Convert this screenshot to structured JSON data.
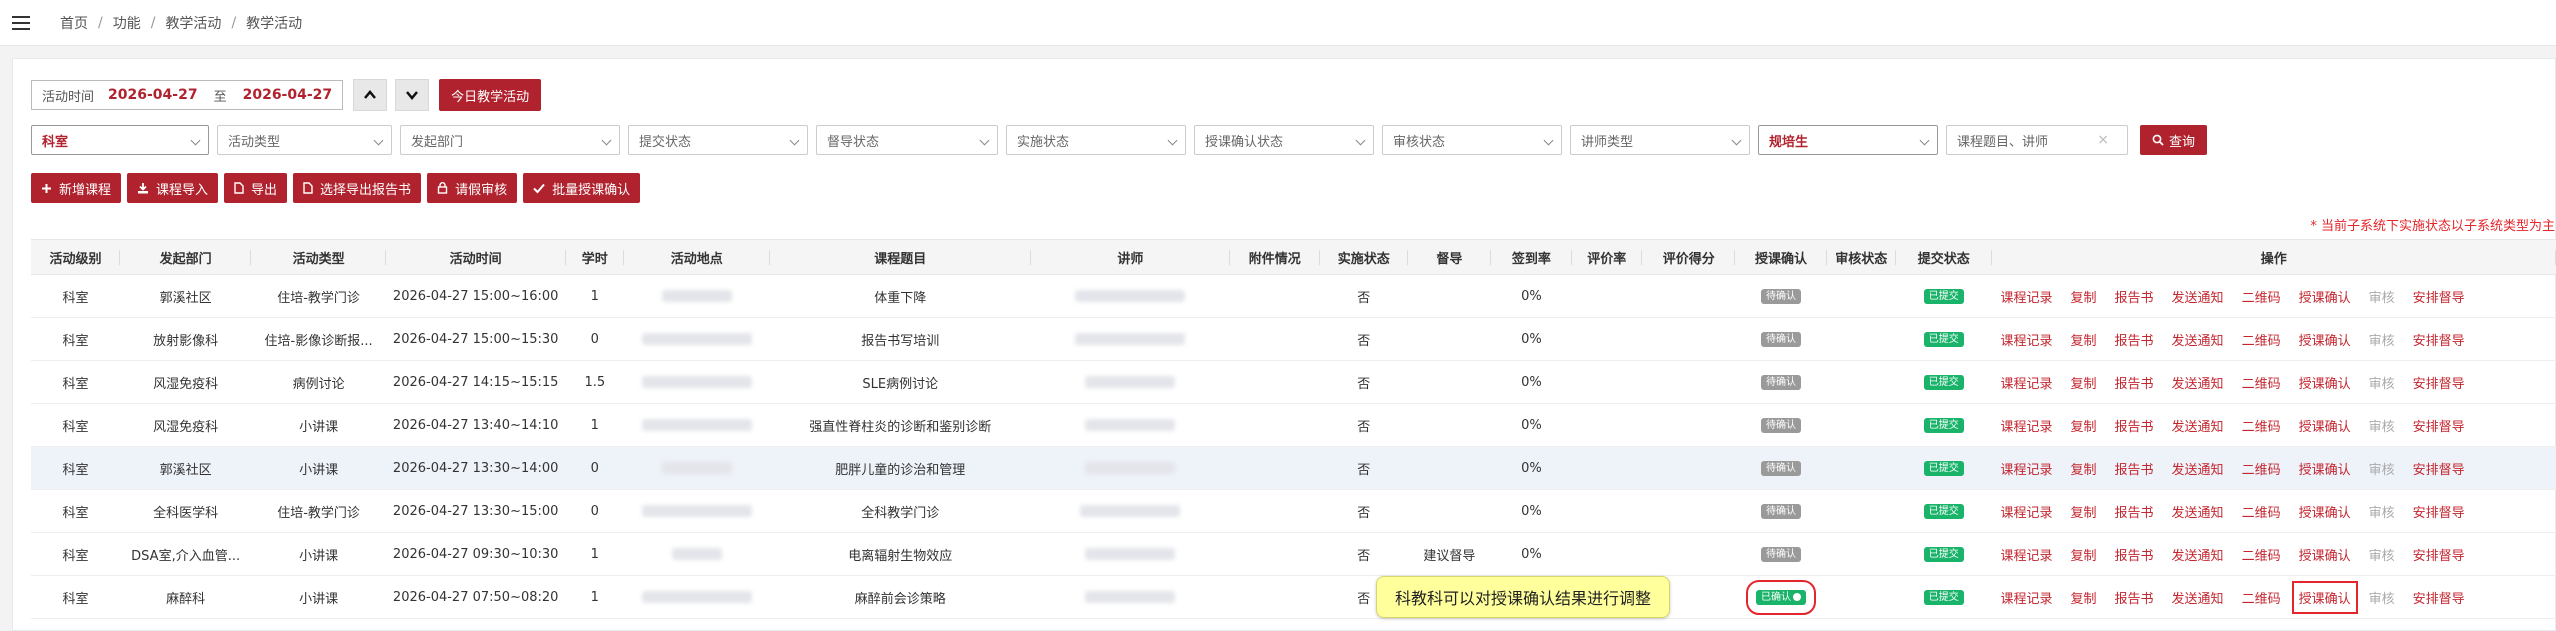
{
  "breadcrumb": [
    "首页",
    "功能",
    "教学活动",
    "教学活动"
  ],
  "datebar": {
    "label": "活动时间",
    "start": "2026-04-27",
    "to": "至",
    "end": "2026-04-27",
    "today_btn": "今日教学活动"
  },
  "filters": [
    {
      "name": "dept-level-select",
      "text": "科室",
      "width": 178,
      "highlight": true
    },
    {
      "name": "activity-type-select",
      "text": "活动类型",
      "width": 175
    },
    {
      "name": "org-dept-select",
      "text": "发起部门",
      "width": 220
    },
    {
      "name": "submit-status-select",
      "text": "提交状态",
      "width": 180
    },
    {
      "name": "supervise-status-select",
      "text": "督导状态",
      "width": 182
    },
    {
      "name": "impl-status-select",
      "text": "实施状态",
      "width": 180
    },
    {
      "name": "lecture-confirm-select",
      "text": "授课确认状态",
      "width": 180
    },
    {
      "name": "audit-status-select",
      "text": "审核状态",
      "width": 180
    },
    {
      "name": "lecturer-type-select",
      "text": "讲师类型",
      "width": 180
    },
    {
      "name": "trainee-select",
      "text": "规培生",
      "width": 180,
      "highlight": true
    },
    {
      "name": "keyword-input",
      "text": "课程题目、讲师",
      "width": 182,
      "clear": true
    }
  ],
  "query_btn": "查询",
  "actions": [
    {
      "name": "add-course-button",
      "icon": "plus",
      "label": "新增课程"
    },
    {
      "name": "import-course-button",
      "icon": "download",
      "label": "课程导入"
    },
    {
      "name": "export-button",
      "icon": "file",
      "label": "导出"
    },
    {
      "name": "export-report-button",
      "icon": "file",
      "label": "选择导出报告书"
    },
    {
      "name": "request-audit-button",
      "icon": "lock",
      "label": "请假审核"
    },
    {
      "name": "batch-confirm-button",
      "icon": "check",
      "label": "批量授课确认"
    }
  ],
  "note": "* 当前子系统下实施状态以子系统类型为主",
  "columns": [
    "活动级别",
    "发起部门",
    "活动类型",
    "活动时间",
    "学时",
    "活动地点",
    "课程题目",
    "讲师",
    "附件情况",
    "实施状态",
    "督导",
    "签到率",
    "评价率",
    "评价得分",
    "授课确认",
    "审核状态",
    "提交状态",
    "操作"
  ],
  "operations": [
    "课程记录",
    "复制",
    "报告书",
    "发送通知",
    "二维码",
    "授课确认",
    "审核",
    "安排督导"
  ],
  "rows": [
    {
      "level": "科室",
      "dept": "郭溪社区",
      "type": "住培-教学门诊",
      "time": "2026-04-27  15:00~16:00",
      "hours": "1",
      "loc_w": 70,
      "title": "体重下降",
      "lec_w": 110,
      "impl": "否",
      "sup": "",
      "sign": "0%",
      "confirm": "待确认",
      "submit": "已提交"
    },
    {
      "level": "科室",
      "dept": "放射影像科",
      "type": "住培-影像诊断报...",
      "time": "2026-04-27  15:00~15:30",
      "hours": "0",
      "loc_w": 110,
      "title": "报告书写培训",
      "lec_w": 110,
      "impl": "否",
      "sup": "",
      "sign": "0%",
      "confirm": "待确认",
      "submit": "已提交"
    },
    {
      "level": "科室",
      "dept": "风湿免疫科",
      "type": "病例讨论",
      "time": "2026-04-27  14:15~15:15",
      "hours": "1.5",
      "loc_w": 110,
      "title": "SLE病例讨论",
      "lec_w": 90,
      "impl": "否",
      "sup": "",
      "sign": "0%",
      "confirm": "待确认",
      "submit": "已提交"
    },
    {
      "level": "科室",
      "dept": "风湿免疫科",
      "type": "小讲课",
      "time": "2026-04-27  13:40~14:10",
      "hours": "1",
      "loc_w": 110,
      "title": "强直性脊柱炎的诊断和鉴别诊断",
      "lec_w": 90,
      "impl": "否",
      "sup": "",
      "sign": "0%",
      "confirm": "待确认",
      "submit": "已提交"
    },
    {
      "level": "科室",
      "dept": "郭溪社区",
      "type": "小讲课",
      "time": "2026-04-27  13:30~14:00",
      "hours": "0",
      "loc_w": 70,
      "title": "肥胖儿童的诊治和管理",
      "lec_w": 90,
      "impl": "否",
      "sup": "",
      "sign": "0%",
      "confirm": "待确认",
      "submit": "已提交"
    },
    {
      "level": "科室",
      "dept": "全科医学科",
      "type": "住培-教学门诊",
      "time": "2026-04-27  13:30~15:00",
      "hours": "0",
      "loc_w": 110,
      "title": "全科教学门诊",
      "lec_w": 100,
      "impl": "否",
      "sup": "",
      "sign": "0%",
      "confirm": "待确认",
      "submit": "已提交"
    },
    {
      "level": "科室",
      "dept": "DSA室,介入血管...",
      "type": "小讲课",
      "time": "2026-04-27  09:30~10:30",
      "hours": "1",
      "loc_w": 50,
      "title": "电离辐射生物效应",
      "lec_w": 90,
      "impl": "否",
      "sup": "建议督导",
      "sign": "0%",
      "confirm": "待确认",
      "submit": "已提交"
    },
    {
      "level": "科室",
      "dept": "麻醉科",
      "type": "小讲课",
      "time": "2026-04-27  07:50~08:20",
      "hours": "1",
      "loc_w": 110,
      "title": "麻醉前会诊策略",
      "lec_w": 90,
      "impl": "否",
      "sup": "",
      "sign": "",
      "confirm": "已确认",
      "submit": "已提交"
    }
  ],
  "tooltip": "科教科可以对授课确认结果进行调整"
}
